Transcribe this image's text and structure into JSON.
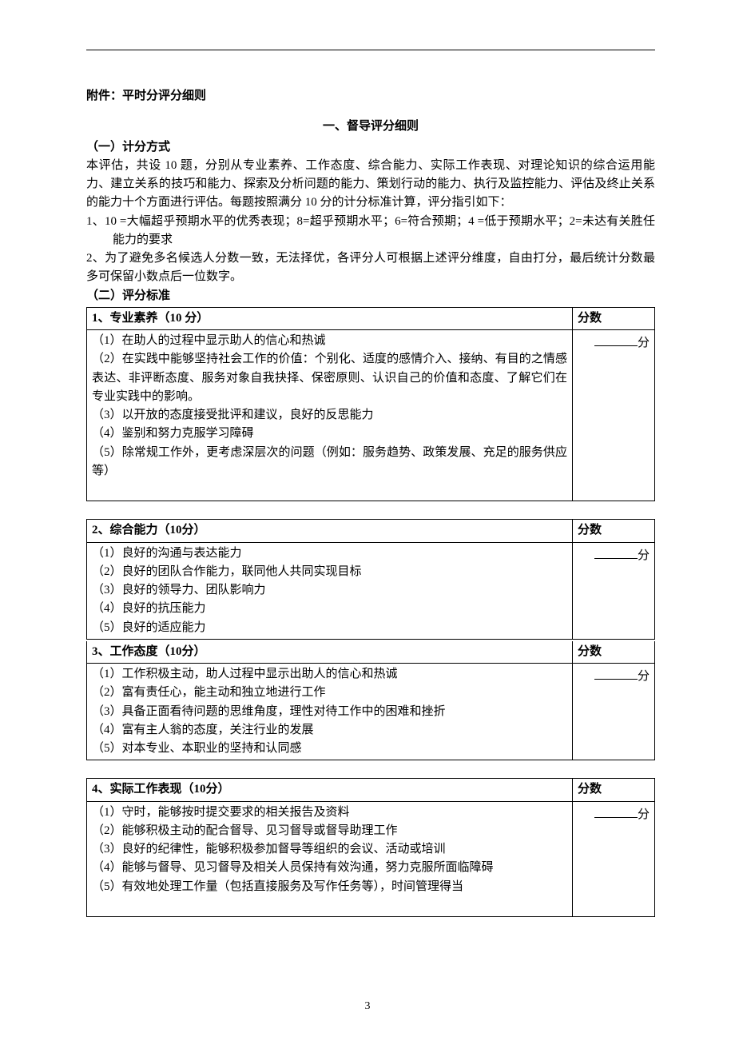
{
  "attachment_label": "附件：平时分评分细则",
  "section_heading": "一、督导评分细则",
  "scoring_method_heading": "（一）计分方式",
  "scoring_method_intro": "本评估，共设 10 题，分别从专业素养、工作态度、综合能力、实际工作表现、对理论知识的综合运用能力、建立关系的技巧和能力、探索及分析问题的能力、策划行动的能力、执行及监控能力、评估及终止关系的能力十个方面进行评估。每题按照满分 10 分的计分标准计算，评分指引如下：",
  "scoring_method_rule1": "1、10 =大幅超乎预期水平的优秀表现；8=超乎预期水平；6=符合预期；4 =低于预期水平；2=未达有关胜任能力的要求",
  "scoring_method_rule2": "2、为了避免多名候选人分数一致，无法择优，各评分人可根据上述评分维度，自由打分，最后统计分数最多可保留小数点后一位数字。",
  "standards_heading": "（二）评分标准",
  "score_header_label": "分数",
  "score_unit_label": "分",
  "page_number": "3",
  "rubrics": [
    {
      "title": "1、专业素养（10 分）",
      "items": [
        "（1）在助人的过程中显示助人的信心和热诚",
        "（2）在实践中能够坚持社会工作的价值：个别化、适度的感情介入、接纳、有目的之情感表达、非评断态度、服务对象自我抉择、保密原则、认识自己的价值和态度、了解它们在专业实践中的影响。",
        "（3）以开放的态度接受批评和建议，良好的反思能力",
        "（4）鉴别和努力克服学习障碍",
        "（5）除常规工作外，更考虑深层次的问题（例如：服务趋势、政策发展、充足的服务供应等）"
      ]
    },
    {
      "title": "2、综合能力（10分）",
      "items": [
        "（1）良好的沟通与表达能力",
        "（2）良好的团队合作能力，联同他人共同实现目标",
        "（3）良好的领导力、团队影响力",
        "（4）良好的抗压能力",
        "（5）良好的适应能力"
      ]
    },
    {
      "title": "3、工作态度（10分）",
      "items": [
        "（1）工作积极主动，助人过程中显示出助人的信心和热诚",
        "（2）富有责任心，能主动和独立地进行工作",
        "（3）具备正面看待问题的思维角度，理性对待工作中的困难和挫折",
        "（4）富有主人翁的态度，关注行业的发展",
        "（5）对本专业、本职业的坚持和认同感"
      ]
    },
    {
      "title": "4、实际工作表现（10分）",
      "items": [
        "（1）守时，能够按时提交要求的相关报告及资料",
        "（2）能够积极主动的配合督导、见习督导或督导助理工作",
        "（3）良好的纪律性，能够积极参加督导等组织的会议、活动或培训",
        "（4）能够与督导、见习督导及相关人员保持有效沟通，努力克服所面临障碍",
        "（5）有效地处理工作量（包括直接服务及写作任务等），时间管理得当"
      ]
    }
  ]
}
